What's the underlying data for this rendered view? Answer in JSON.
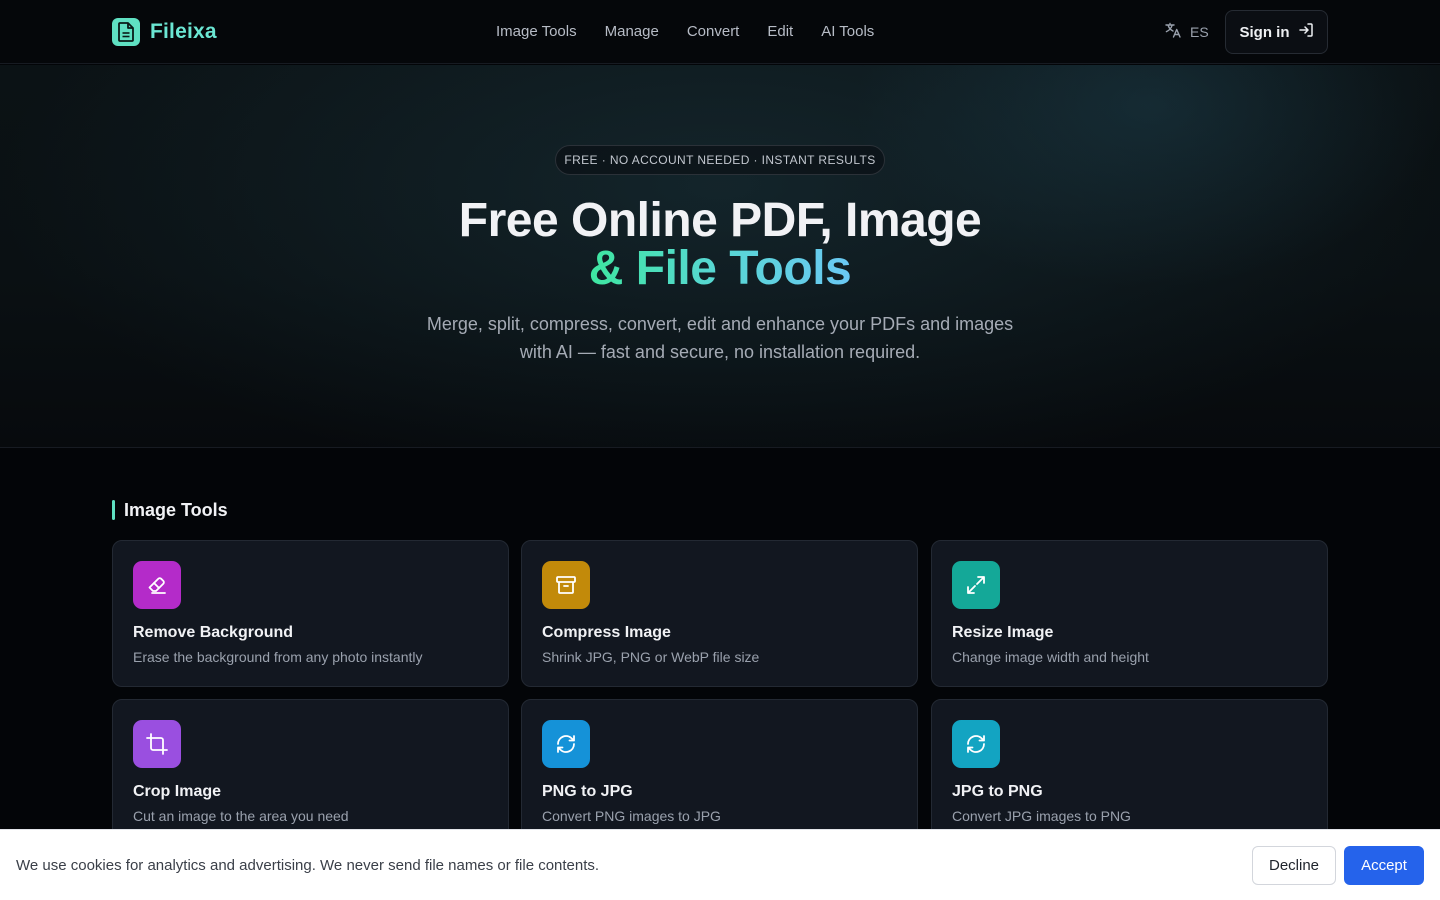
{
  "brand": {
    "name": "Fileixa",
    "logo_icon": "file-icon",
    "logo_color": "#5fe0c2"
  },
  "nav": {
    "items": [
      "Image Tools",
      "Manage",
      "Convert",
      "Edit",
      "AI Tools"
    ]
  },
  "language": {
    "icon": "translate-icon",
    "code": "ES"
  },
  "signin": {
    "label": "Sign in",
    "icon": "sign-in-icon"
  },
  "hero": {
    "badge": "FREE · NO ACCOUNT NEEDED · INSTANT RESULTS",
    "title_line1": "Free Online PDF, Image",
    "title_line2_prefix": "& ",
    "title_line2_accent": "File Tools",
    "subtitle": "Merge, split, compress, convert, edit and enhance your PDFs and images with AI — fast and secure, no installation required."
  },
  "section": {
    "title": "Image Tools",
    "accent_color": "#5fe0c2",
    "tools": [
      {
        "title": "Remove Background",
        "desc": "Erase the background from any photo instantly",
        "icon": "eraser-icon",
        "color": "#b42bc9"
      },
      {
        "title": "Compress Image",
        "desc": "Shrink JPG, PNG or WebP file size",
        "icon": "archive-icon",
        "color": "#c28a0a"
      },
      {
        "title": "Resize Image",
        "desc": "Change image width and height",
        "icon": "expand-icon",
        "color": "#14a898"
      },
      {
        "title": "Crop Image",
        "desc": "Cut an image to the area you need",
        "icon": "crop-icon",
        "color": "#9a4fe0"
      },
      {
        "title": "PNG to JPG",
        "desc": "Convert PNG images to JPG",
        "icon": "refresh-icon",
        "color": "#1592d8"
      },
      {
        "title": "JPG to PNG",
        "desc": "Convert JPG images to PNG",
        "icon": "refresh-icon",
        "color": "#13a4c2"
      }
    ]
  },
  "cookie": {
    "text": "We use cookies for analytics and advertising. We never send file names or file contents.",
    "decline": "Decline",
    "accept": "Accept",
    "accept_color": "#2563eb"
  }
}
